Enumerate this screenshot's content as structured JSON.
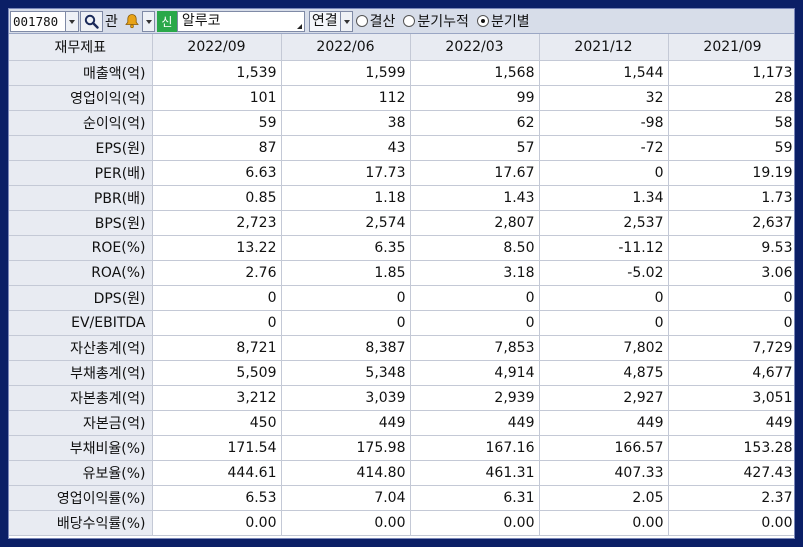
{
  "toolbar": {
    "code": "001780",
    "tab_label": "관",
    "new_badge": "신",
    "company_name": "알루코",
    "consolidation": "연결",
    "radios": [
      {
        "label": "결산",
        "selected": false
      },
      {
        "label": "분기누적",
        "selected": false
      },
      {
        "label": "분기별",
        "selected": true
      }
    ]
  },
  "table": {
    "header_label": "재무제표",
    "columns": [
      "2022/09",
      "2022/06",
      "2022/03",
      "2021/12",
      "2021/09"
    ],
    "rows": [
      {
        "label": "매출액(억)",
        "values": [
          "1,539",
          "1,599",
          "1,568",
          "1,544",
          "1,173"
        ]
      },
      {
        "label": "영업이익(억)",
        "values": [
          "101",
          "112",
          "99",
          "32",
          "28"
        ]
      },
      {
        "label": "순이익(억)",
        "values": [
          "59",
          "38",
          "62",
          "-98",
          "58"
        ]
      },
      {
        "label": "EPS(원)",
        "values": [
          "87",
          "43",
          "57",
          "-72",
          "59"
        ]
      },
      {
        "label": "PER(배)",
        "values": [
          "6.63",
          "17.73",
          "17.67",
          "0",
          "19.19"
        ]
      },
      {
        "label": "PBR(배)",
        "values": [
          "0.85",
          "1.18",
          "1.43",
          "1.34",
          "1.73"
        ]
      },
      {
        "label": "BPS(원)",
        "values": [
          "2,723",
          "2,574",
          "2,807",
          "2,537",
          "2,637"
        ]
      },
      {
        "label": "ROE(%)",
        "values": [
          "13.22",
          "6.35",
          "8.50",
          "-11.12",
          "9.53"
        ]
      },
      {
        "label": "ROA(%)",
        "values": [
          "2.76",
          "1.85",
          "3.18",
          "-5.02",
          "3.06"
        ]
      },
      {
        "label": "DPS(원)",
        "values": [
          "0",
          "0",
          "0",
          "0",
          "0"
        ]
      },
      {
        "label": "EV/EBITDA",
        "values": [
          "0",
          "0",
          "0",
          "0",
          "0"
        ]
      },
      {
        "label": "자산총계(억)",
        "values": [
          "8,721",
          "8,387",
          "7,853",
          "7,802",
          "7,729"
        ]
      },
      {
        "label": "부채총계(억)",
        "values": [
          "5,509",
          "5,348",
          "4,914",
          "4,875",
          "4,677"
        ]
      },
      {
        "label": "자본총계(억)",
        "values": [
          "3,212",
          "3,039",
          "2,939",
          "2,927",
          "3,051"
        ]
      },
      {
        "label": "자본금(억)",
        "values": [
          "450",
          "449",
          "449",
          "449",
          "449"
        ]
      },
      {
        "label": "부채비율(%)",
        "values": [
          "171.54",
          "175.98",
          "167.16",
          "166.57",
          "153.28"
        ]
      },
      {
        "label": "유보율(%)",
        "values": [
          "444.61",
          "414.80",
          "461.31",
          "407.33",
          "427.43"
        ]
      },
      {
        "label": "영업이익률(%)",
        "values": [
          "6.53",
          "7.04",
          "6.31",
          "2.05",
          "2.37"
        ]
      },
      {
        "label": "배당수익률(%)",
        "values": [
          "0.00",
          "0.00",
          "0.00",
          "0.00",
          "0.00"
        ]
      }
    ]
  },
  "colors": {
    "background": "#0b1f66",
    "toolbar": "#d7dde9",
    "header_cell": "#e8ebf2",
    "new_badge": "#2aa84a",
    "bell": "#e8a317"
  },
  "icons": [
    "chevron-down-icon",
    "search-icon",
    "bell-icon"
  ]
}
